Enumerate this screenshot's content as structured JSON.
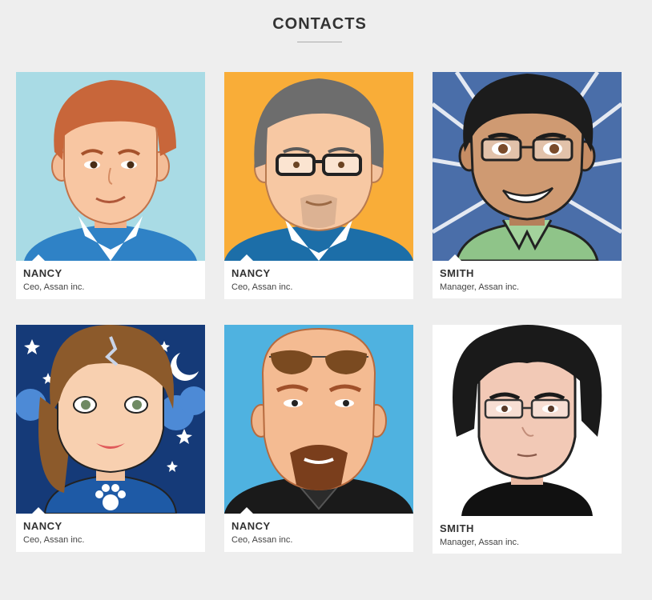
{
  "section": {
    "title": "CONTACTS"
  },
  "contacts": [
    {
      "name": "NANCY",
      "role": "Ceo, Assan inc.",
      "avatar_bg": "#a9dbe5",
      "avatar_icon": "cartoon-redhead-man-avatar"
    },
    {
      "name": "NANCY",
      "role": "Ceo, Assan inc.",
      "avatar_bg": "#f9ad38",
      "avatar_icon": "cartoon-grey-haired-man-glasses-avatar"
    },
    {
      "name": "SMITH",
      "role": "Manager, Assan inc.",
      "avatar_bg": "#4a6ea9",
      "avatar_icon": "cartoon-smiling-man-glasses-avatar"
    },
    {
      "name": "NANCY",
      "role": "Ceo, Assan inc.",
      "avatar_bg": "#153a78",
      "avatar_icon": "cartoon-woman-night-sky-avatar"
    },
    {
      "name": "NANCY",
      "role": "Ceo, Assan inc.",
      "avatar_bg": "#4fb2e0",
      "avatar_icon": "cartoon-bald-man-sunglasses-avatar"
    },
    {
      "name": "SMITH",
      "role": "Manager, Assan inc.",
      "avatar_bg": "#ffffff",
      "avatar_icon": "cartoon-black-haired-man-glasses-avatar"
    }
  ]
}
